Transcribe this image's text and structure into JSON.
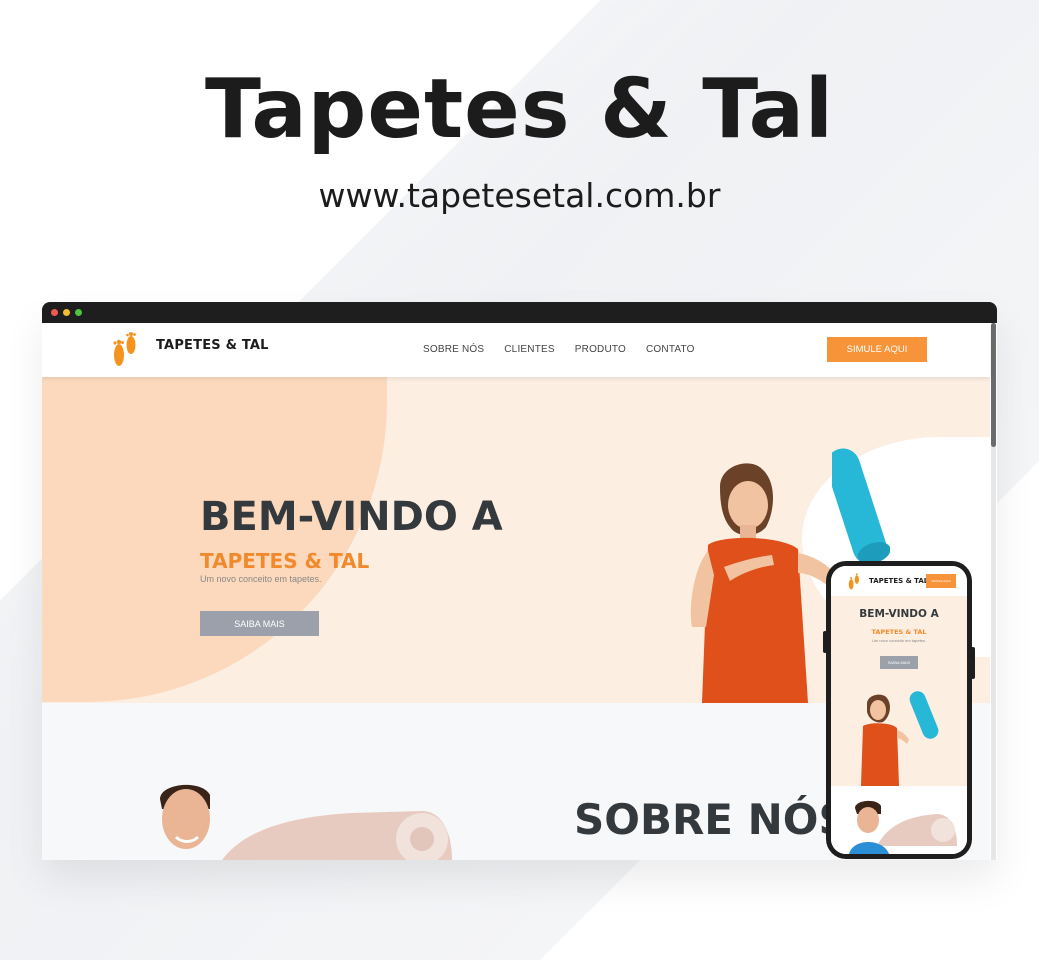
{
  "promo": {
    "title": "Tapetes & Tal",
    "url": "www.tapetesetal.com.br"
  },
  "site": {
    "logo_text": "TAPETES & TAL",
    "nav": [
      "SOBRE NÓS",
      "CLIENTES",
      "PRODUTO",
      "CONTATO"
    ],
    "cta_label": "SIMULE AQUI",
    "hero": {
      "heading": "BEM-VINDO A",
      "brand": "TAPETES & TAL",
      "tagline": "Um novo conceito em tapetes.",
      "button_label": "SAIBA MAIS"
    },
    "about_title": "SOBRE NÓS"
  },
  "mobile": {
    "logo_text": "TAPETES & TAL",
    "cta_label": "SIMULE AQUI",
    "heading": "BEM-VINDO A",
    "brand": "TAPETES & TAL",
    "tagline": "Um novo conceito em tapetes.",
    "button_label": "SAIBA MAIS"
  },
  "colors": {
    "accent": "#f7943a",
    "hero_bg": "#fdeee2",
    "heading": "#34393d",
    "button_gray": "#9ba0aa",
    "mat_blue": "#27b8d8"
  },
  "icons": [
    "footprints-logo-icon"
  ]
}
